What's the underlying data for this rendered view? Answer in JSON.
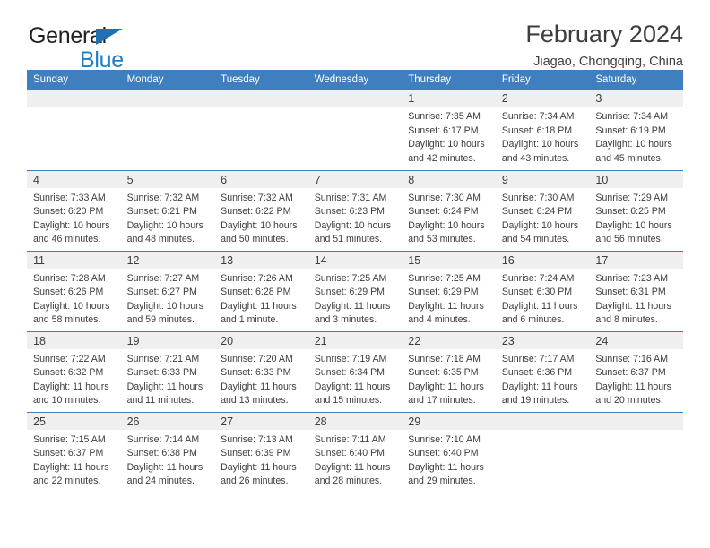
{
  "brand": {
    "name_top": "General",
    "name_bottom": "Blue",
    "triangle_color": "#1f6fb5",
    "bottom_color": "#1f7ec4"
  },
  "header": {
    "title": "February 2024",
    "subtitle": "Jiagao, Chongqing, China",
    "header_bg": "#3f7fbf",
    "daynum_bg": "#efefef"
  },
  "weekdays": [
    "Sunday",
    "Monday",
    "Tuesday",
    "Wednesday",
    "Thursday",
    "Friday",
    "Saturday"
  ],
  "labels": {
    "sunrise": "Sunrise:",
    "sunset": "Sunset:",
    "daylight": "Daylight:"
  },
  "weeks": [
    [
      {
        "day": "",
        "blank": true,
        "sunrise": "",
        "sunset": "",
        "daylight_1": "",
        "daylight_2": ""
      },
      {
        "day": "",
        "blank": true,
        "sunrise": "",
        "sunset": "",
        "daylight_1": "",
        "daylight_2": ""
      },
      {
        "day": "",
        "blank": true,
        "sunrise": "",
        "sunset": "",
        "daylight_1": "",
        "daylight_2": ""
      },
      {
        "day": "",
        "blank": true,
        "sunrise": "",
        "sunset": "",
        "daylight_1": "",
        "daylight_2": ""
      },
      {
        "day": "1",
        "blank": false,
        "sunrise": "Sunrise: 7:35 AM",
        "sunset": "Sunset: 6:17 PM",
        "daylight_1": "Daylight: 10 hours",
        "daylight_2": "and 42 minutes."
      },
      {
        "day": "2",
        "blank": false,
        "sunrise": "Sunrise: 7:34 AM",
        "sunset": "Sunset: 6:18 PM",
        "daylight_1": "Daylight: 10 hours",
        "daylight_2": "and 43 minutes."
      },
      {
        "day": "3",
        "blank": false,
        "sunrise": "Sunrise: 7:34 AM",
        "sunset": "Sunset: 6:19 PM",
        "daylight_1": "Daylight: 10 hours",
        "daylight_2": "and 45 minutes."
      }
    ],
    [
      {
        "day": "4",
        "blank": false,
        "sunrise": "Sunrise: 7:33 AM",
        "sunset": "Sunset: 6:20 PM",
        "daylight_1": "Daylight: 10 hours",
        "daylight_2": "and 46 minutes."
      },
      {
        "day": "5",
        "blank": false,
        "sunrise": "Sunrise: 7:32 AM",
        "sunset": "Sunset: 6:21 PM",
        "daylight_1": "Daylight: 10 hours",
        "daylight_2": "and 48 minutes."
      },
      {
        "day": "6",
        "blank": false,
        "sunrise": "Sunrise: 7:32 AM",
        "sunset": "Sunset: 6:22 PM",
        "daylight_1": "Daylight: 10 hours",
        "daylight_2": "and 50 minutes."
      },
      {
        "day": "7",
        "blank": false,
        "sunrise": "Sunrise: 7:31 AM",
        "sunset": "Sunset: 6:23 PM",
        "daylight_1": "Daylight: 10 hours",
        "daylight_2": "and 51 minutes."
      },
      {
        "day": "8",
        "blank": false,
        "sunrise": "Sunrise: 7:30 AM",
        "sunset": "Sunset: 6:24 PM",
        "daylight_1": "Daylight: 10 hours",
        "daylight_2": "and 53 minutes."
      },
      {
        "day": "9",
        "blank": false,
        "sunrise": "Sunrise: 7:30 AM",
        "sunset": "Sunset: 6:24 PM",
        "daylight_1": "Daylight: 10 hours",
        "daylight_2": "and 54 minutes."
      },
      {
        "day": "10",
        "blank": false,
        "sunrise": "Sunrise: 7:29 AM",
        "sunset": "Sunset: 6:25 PM",
        "daylight_1": "Daylight: 10 hours",
        "daylight_2": "and 56 minutes."
      }
    ],
    [
      {
        "day": "11",
        "blank": false,
        "sunrise": "Sunrise: 7:28 AM",
        "sunset": "Sunset: 6:26 PM",
        "daylight_1": "Daylight: 10 hours",
        "daylight_2": "and 58 minutes."
      },
      {
        "day": "12",
        "blank": false,
        "sunrise": "Sunrise: 7:27 AM",
        "sunset": "Sunset: 6:27 PM",
        "daylight_1": "Daylight: 10 hours",
        "daylight_2": "and 59 minutes."
      },
      {
        "day": "13",
        "blank": false,
        "sunrise": "Sunrise: 7:26 AM",
        "sunset": "Sunset: 6:28 PM",
        "daylight_1": "Daylight: 11 hours",
        "daylight_2": "and 1 minute."
      },
      {
        "day": "14",
        "blank": false,
        "sunrise": "Sunrise: 7:25 AM",
        "sunset": "Sunset: 6:29 PM",
        "daylight_1": "Daylight: 11 hours",
        "daylight_2": "and 3 minutes."
      },
      {
        "day": "15",
        "blank": false,
        "sunrise": "Sunrise: 7:25 AM",
        "sunset": "Sunset: 6:29 PM",
        "daylight_1": "Daylight: 11 hours",
        "daylight_2": "and 4 minutes."
      },
      {
        "day": "16",
        "blank": false,
        "sunrise": "Sunrise: 7:24 AM",
        "sunset": "Sunset: 6:30 PM",
        "daylight_1": "Daylight: 11 hours",
        "daylight_2": "and 6 minutes."
      },
      {
        "day": "17",
        "blank": false,
        "sunrise": "Sunrise: 7:23 AM",
        "sunset": "Sunset: 6:31 PM",
        "daylight_1": "Daylight: 11 hours",
        "daylight_2": "and 8 minutes."
      }
    ],
    [
      {
        "day": "18",
        "blank": false,
        "sunrise": "Sunrise: 7:22 AM",
        "sunset": "Sunset: 6:32 PM",
        "daylight_1": "Daylight: 11 hours",
        "daylight_2": "and 10 minutes."
      },
      {
        "day": "19",
        "blank": false,
        "sunrise": "Sunrise: 7:21 AM",
        "sunset": "Sunset: 6:33 PM",
        "daylight_1": "Daylight: 11 hours",
        "daylight_2": "and 11 minutes."
      },
      {
        "day": "20",
        "blank": false,
        "sunrise": "Sunrise: 7:20 AM",
        "sunset": "Sunset: 6:33 PM",
        "daylight_1": "Daylight: 11 hours",
        "daylight_2": "and 13 minutes."
      },
      {
        "day": "21",
        "blank": false,
        "sunrise": "Sunrise: 7:19 AM",
        "sunset": "Sunset: 6:34 PM",
        "daylight_1": "Daylight: 11 hours",
        "daylight_2": "and 15 minutes."
      },
      {
        "day": "22",
        "blank": false,
        "sunrise": "Sunrise: 7:18 AM",
        "sunset": "Sunset: 6:35 PM",
        "daylight_1": "Daylight: 11 hours",
        "daylight_2": "and 17 minutes."
      },
      {
        "day": "23",
        "blank": false,
        "sunrise": "Sunrise: 7:17 AM",
        "sunset": "Sunset: 6:36 PM",
        "daylight_1": "Daylight: 11 hours",
        "daylight_2": "and 19 minutes."
      },
      {
        "day": "24",
        "blank": false,
        "sunrise": "Sunrise: 7:16 AM",
        "sunset": "Sunset: 6:37 PM",
        "daylight_1": "Daylight: 11 hours",
        "daylight_2": "and 20 minutes."
      }
    ],
    [
      {
        "day": "25",
        "blank": false,
        "sunrise": "Sunrise: 7:15 AM",
        "sunset": "Sunset: 6:37 PM",
        "daylight_1": "Daylight: 11 hours",
        "daylight_2": "and 22 minutes."
      },
      {
        "day": "26",
        "blank": false,
        "sunrise": "Sunrise: 7:14 AM",
        "sunset": "Sunset: 6:38 PM",
        "daylight_1": "Daylight: 11 hours",
        "daylight_2": "and 24 minutes."
      },
      {
        "day": "27",
        "blank": false,
        "sunrise": "Sunrise: 7:13 AM",
        "sunset": "Sunset: 6:39 PM",
        "daylight_1": "Daylight: 11 hours",
        "daylight_2": "and 26 minutes."
      },
      {
        "day": "28",
        "blank": false,
        "sunrise": "Sunrise: 7:11 AM",
        "sunset": "Sunset: 6:40 PM",
        "daylight_1": "Daylight: 11 hours",
        "daylight_2": "and 28 minutes."
      },
      {
        "day": "29",
        "blank": false,
        "sunrise": "Sunrise: 7:10 AM",
        "sunset": "Sunset: 6:40 PM",
        "daylight_1": "Daylight: 11 hours",
        "daylight_2": "and 29 minutes."
      },
      {
        "day": "",
        "blank": true,
        "sunrise": "",
        "sunset": "",
        "daylight_1": "",
        "daylight_2": ""
      },
      {
        "day": "",
        "blank": true,
        "sunrise": "",
        "sunset": "",
        "daylight_1": "",
        "daylight_2": ""
      }
    ]
  ]
}
